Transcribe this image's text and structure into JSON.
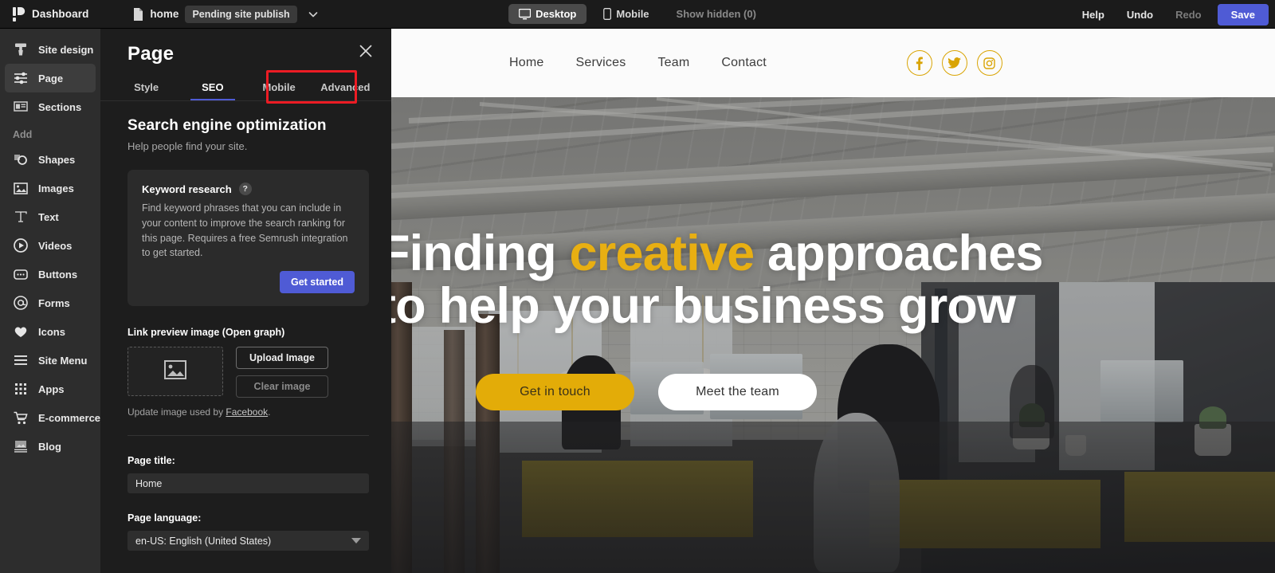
{
  "topbar": {
    "brand": {
      "label": "Dashboard",
      "icon": "pagecloud-logo-icon"
    },
    "breadcrumb": {
      "page_name": "home",
      "status": "Pending site publish",
      "file_icon": "file-icon",
      "chevron_icon": "chevron-down-icon"
    },
    "viewport": {
      "desktop": {
        "label": "Desktop",
        "icon": "monitor-icon",
        "active": true
      },
      "mobile": {
        "label": "Mobile",
        "icon": "phone-icon",
        "active": false
      },
      "show_hidden": {
        "label": "Show hidden (0)",
        "count": 0
      }
    },
    "actions": {
      "help": "Help",
      "undo": "Undo",
      "redo": "Redo",
      "save": "Save"
    },
    "colors": {
      "save_button": "#4f5bd5",
      "bar_bg": "#1b1b1b"
    }
  },
  "rail": {
    "items": [
      {
        "label": "Site design",
        "icon": "paint-roller-icon",
        "selected": false
      },
      {
        "label": "Page",
        "icon": "sliders-icon",
        "selected": true
      },
      {
        "label": "Sections",
        "icon": "layout-icon",
        "selected": false
      }
    ],
    "section_label": "Add",
    "add_items": [
      {
        "label": "Shapes",
        "icon": "shapes-icon"
      },
      {
        "label": "Images",
        "icon": "image-icon"
      },
      {
        "label": "Text",
        "icon": "text-t-icon"
      },
      {
        "label": "Videos",
        "icon": "play-circle-icon"
      },
      {
        "label": "Buttons",
        "icon": "button-icon"
      },
      {
        "label": "Forms",
        "icon": "at-circle-icon"
      },
      {
        "label": "Icons",
        "icon": "heart-icon"
      },
      {
        "label": "Site Menu",
        "icon": "hamburger-icon"
      },
      {
        "label": "Apps",
        "icon": "grid-dots-icon"
      },
      {
        "label": "E-commerce",
        "icon": "shopping-cart-icon"
      },
      {
        "label": "Blog",
        "icon": "blog-icon"
      }
    ]
  },
  "panel": {
    "title": "Page",
    "close_icon": "close-icon",
    "tabs": [
      {
        "label": "Style",
        "active": false
      },
      {
        "label": "SEO",
        "active": true
      },
      {
        "label": "Mobile",
        "active": false
      },
      {
        "label": "Advanced",
        "active": false
      }
    ],
    "highlight": {
      "target_tab": "SEO",
      "color": "#ec1c24"
    },
    "section": {
      "title": "Search engine optimization",
      "subtitle": "Help people find your site."
    },
    "keyword_card": {
      "title": "Keyword research",
      "help_icon": "question-mark-icon",
      "body": "Find keyword phrases that you can include in your content to improve the search ranking for this page. Requires a free Semrush integration to get started.",
      "button": "Get started"
    },
    "og": {
      "label": "Link preview image (Open graph)",
      "thumb_icon": "image-placeholder-icon",
      "upload_button": "Upload Image",
      "clear_button": "Clear image",
      "note_prefix": "Update image used by ",
      "note_link": "Facebook",
      "note_suffix": "."
    },
    "page_title": {
      "label": "Page title:",
      "value": "Home"
    },
    "page_language": {
      "label": "Page language:",
      "value": "en-US: English (United States)",
      "caret_icon": "caret-down-icon"
    }
  },
  "preview": {
    "site_nav": [
      {
        "label": "Home"
      },
      {
        "label": "Services"
      },
      {
        "label": "Team"
      },
      {
        "label": "Contact"
      }
    ],
    "socials": [
      {
        "name": "facebook-icon",
        "glyph": "f"
      },
      {
        "name": "twitter-icon",
        "glyph": "t"
      },
      {
        "name": "instagram-icon",
        "glyph": "i"
      }
    ],
    "hero": {
      "line1_a": "Finding ",
      "line1_accent": "creative",
      "line1_b": " approaches",
      "line2": "to help your business grow",
      "buttons": [
        {
          "label": "Get in touch",
          "style": "gold"
        },
        {
          "label": "Meet the team",
          "style": "white"
        }
      ],
      "accent_color": "#e8af12",
      "primary_button_color": "#e3ac08"
    }
  }
}
